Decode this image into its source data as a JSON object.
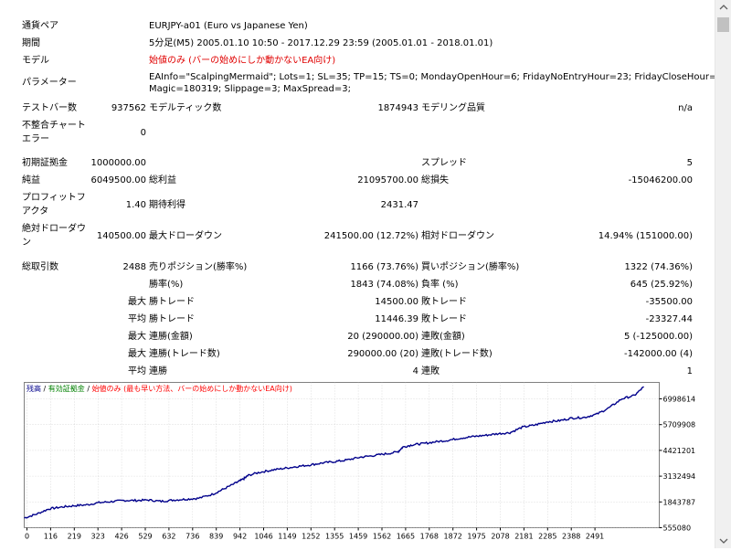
{
  "report": {
    "labels": {
      "symbol": "通貨ペア",
      "period": "期間",
      "model": "モデル",
      "parameters": "パラメーター",
      "test_bars": "テストバー数",
      "model_ticks": "モデルティック数",
      "modeling_quality": "モデリング品質",
      "mismatch_errors_1": "不整合チャート",
      "mismatch_errors_2": "エラー",
      "initial_deposit": "初期証拠金",
      "spread": "スプレッド",
      "net_profit": "純益",
      "gross_profit": "総利益",
      "gross_loss": "総損失",
      "profit_factor_1": "プロフィットフ",
      "profit_factor_2": "アクタ",
      "expected_payoff": "期待利得",
      "absolute_dd_1": "絶対ドローダウ",
      "absolute_dd_2": "ン",
      "maximal_dd": "最大ドローダウン",
      "relative_dd": "相対ドローダウン",
      "total_trades": "総取引数",
      "short_positions": "売りポジション(勝率%)",
      "long_positions": "買いポジション(勝率%)",
      "profit_trades": "勝率(%)",
      "loss_trades": "負率 (%)",
      "largest": "最大",
      "average": "平均",
      "maximum": "最大",
      "maximal": "最大",
      "avg": "平均",
      "profit_trade": "勝トレード",
      "loss_trade": "敗トレード",
      "consecutive_wins_money": "連勝(金額)",
      "consecutive_losses_money": "連敗(金額)",
      "consecutive_wins_count": "連勝(トレード数)",
      "consecutive_losses_count": "連敗(トレード数)",
      "consecutive_wins": "連勝",
      "consecutive_losses": "連敗"
    },
    "values": {
      "symbol": "EURJPY-a01 (Euro vs Japanese Yen)",
      "period": "5分足(M5) 2005.01.10 10:50 - 2017.12.29 23:59 (2005.01.01 - 2018.01.01)",
      "model": "始値のみ (バーの始めにしか動かないEA向け)",
      "parameters_line1": "EAInfo=\"ScalpingMermaid\"; Lots=1; SL=35; TP=15; TS=0; MondayOpenHour=6; FridayNoEntryHour=23; FridayCloseHour=23;",
      "parameters_line2": "Magic=180319; Slippage=3; MaxSpread=3;",
      "test_bars": "937562",
      "model_ticks": "1874943",
      "modeling_quality": "n/a",
      "mismatch_errors": "0",
      "initial_deposit": "1000000.00",
      "spread": "5",
      "net_profit": "6049500.00",
      "gross_profit": "21095700.00",
      "gross_loss": "-15046200.00",
      "profit_factor": "1.40",
      "expected_payoff": "2431.47",
      "absolute_dd": "140500.00",
      "maximal_dd": "241500.00 (12.72%)",
      "relative_dd": "14.94% (151000.00)",
      "total_trades": "2488",
      "short_positions": "1166 (73.76%)",
      "long_positions": "1322 (74.36%)",
      "profit_trades": "1843 (74.08%)",
      "loss_trades": "645 (25.92%)",
      "largest_profit": "14500.00",
      "largest_loss": "-35500.00",
      "average_profit": "11446.39",
      "average_loss": "-23327.44",
      "max_cons_wins_money": "20 (290000.00)",
      "max_cons_losses_money": "5 (-125000.00)",
      "max_cons_wins_count": "290000.00 (20)",
      "max_cons_losses_count": "-142000.00 (4)",
      "avg_cons_wins": "4",
      "avg_cons_losses": "1"
    }
  },
  "chart_data": {
    "type": "line",
    "legend": {
      "balance": "残高",
      "sep1": " / ",
      "equity": "有効証拠金",
      "sep2": " / ",
      "model": "始値のみ (最も早い方法、バーの始めにしか動かないEA向け)"
    },
    "colors": {
      "balance": "#00008b",
      "equity": "#008000",
      "model": "#ff0000",
      "grid": "#c0c0c0"
    },
    "x_ticks": [
      "0",
      "116",
      "219",
      "323",
      "426",
      "529",
      "632",
      "736",
      "839",
      "942",
      "1046",
      "1149",
      "1252",
      "1355",
      "1459",
      "1562",
      "1665",
      "1768",
      "1872",
      "1975",
      "2078",
      "2181",
      "2285",
      "2388",
      "2491"
    ],
    "y_ticks": [
      "6998614",
      "5709908",
      "4421201",
      "3132494",
      "1843787",
      "555080"
    ],
    "xlim": [
      0,
      2550
    ],
    "ylim": [
      555080,
      7200000
    ],
    "series": [
      {
        "values": [
          [
            0,
            1000000
          ],
          [
            50,
            1180000
          ],
          [
            100,
            1420000
          ],
          [
            150,
            1500000
          ],
          [
            200,
            1560000
          ],
          [
            250,
            1600000
          ],
          [
            300,
            1700000
          ],
          [
            350,
            1750000
          ],
          [
            400,
            1800000
          ],
          [
            450,
            1800000
          ],
          [
            500,
            1820000
          ],
          [
            550,
            1760000
          ],
          [
            600,
            1820000
          ],
          [
            650,
            1860000
          ],
          [
            700,
            1900000
          ],
          [
            760,
            2100000
          ],
          [
            800,
            2320000
          ],
          [
            850,
            2600000
          ],
          [
            880,
            2780000
          ],
          [
            900,
            2950000
          ],
          [
            950,
            3100000
          ],
          [
            1000,
            3200000
          ],
          [
            1050,
            3280000
          ],
          [
            1100,
            3360000
          ],
          [
            1150,
            3430000
          ],
          [
            1200,
            3520000
          ],
          [
            1250,
            3580000
          ],
          [
            1300,
            3660000
          ],
          [
            1350,
            3780000
          ],
          [
            1400,
            3850000
          ],
          [
            1450,
            3930000
          ],
          [
            1500,
            4020000
          ],
          [
            1520,
            4240000
          ],
          [
            1560,
            4350000
          ],
          [
            1600,
            4400000
          ],
          [
            1650,
            4480000
          ],
          [
            1700,
            4550000
          ],
          [
            1750,
            4650000
          ],
          [
            1800,
            4720000
          ],
          [
            1850,
            4780000
          ],
          [
            1900,
            4850000
          ],
          [
            1950,
            4900000
          ],
          [
            2000,
            5150000
          ],
          [
            2050,
            5250000
          ],
          [
            2100,
            5400000
          ],
          [
            2150,
            5450000
          ],
          [
            2200,
            5570000
          ],
          [
            2250,
            5600000
          ],
          [
            2300,
            5750000
          ],
          [
            2350,
            6050000
          ],
          [
            2400,
            6450000
          ],
          [
            2450,
            6600000
          ],
          [
            2488,
            7000000
          ]
        ]
      }
    ]
  }
}
